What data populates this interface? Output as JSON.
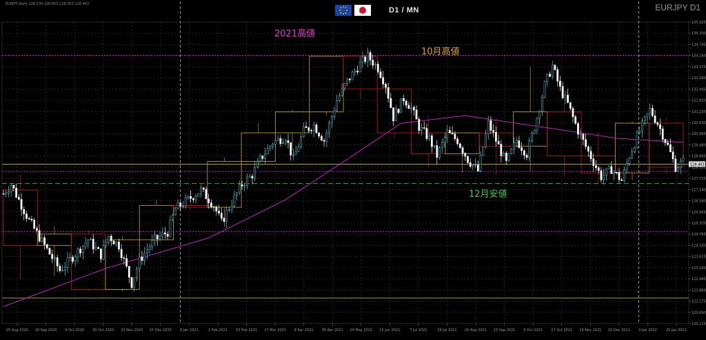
{
  "header": {
    "symbol_info": "EURJPY,Daily  128.530 128.853 128.353 128.463",
    "timeframe_label": "D1 / MN",
    "symbol_title": "EURJPY D1"
  },
  "flags": {
    "left": "eu-flag-icon",
    "right": "japan-flag-icon"
  },
  "colors": {
    "background": "#000000",
    "grid": "#3a3a3a",
    "bull_candle": "#5fd3e0",
    "bear_candle": "#ffffff",
    "ma_line": "#c020c0",
    "monthly_box_bull": "#b8962a",
    "monthly_box_bear": "#b01818",
    "level_magenta": "#d020d0",
    "level_green_dashed": "#22a040",
    "level_khaki": "#9c9c40"
  },
  "annotations": {
    "high_2021": "2021高値",
    "oct_high": "10月高値",
    "dec_low": "12月安値"
  },
  "chart_data": {
    "type": "candlestick",
    "symbol": "EURJPY",
    "timeframe": "Daily",
    "ylim": [
      120.115,
      135.9
    ],
    "y_tick_labels": [
      "135.925",
      "135.330",
      "134.745",
      "134.160",
      "133.575",
      "133.000",
      "132.405",
      "131.820",
      "131.235",
      "130.650",
      "130.065",
      "129.480",
      "128.895",
      "128.310",
      "127.725",
      "127.140",
      "126.540",
      "125.955",
      "125.370",
      "124.785",
      "124.200",
      "123.615",
      "123.030",
      "122.445",
      "121.860",
      "121.275",
      "120.690",
      "120.115"
    ],
    "x_tick_labels": [
      "25 Aug 2020",
      "16 Sep 2020",
      "8 Oct 2020",
      "30 Oct 2020",
      "23 Nov 2020",
      "15 Dec 2020",
      "8 Jan 2021",
      "1 Feb 2021",
      "23 Feb 2021",
      "17 Mar 2021",
      "8 Apr 2021",
      "30 Apr 2021",
      "24 May 2021",
      "15 Jun 2021",
      "7 Jul 2021",
      "29 Jul 2021",
      "20 Aug 2021",
      "13 Sep 2021",
      "5 Oct 2021",
      "27 Oct 2021",
      "18 Nov 2021",
      "10 Dec 2021",
      "3 Jan 2022",
      "25 Jan 2022"
    ],
    "price_path": [
      [
        0,
        126.9
      ],
      [
        3,
        127.4
      ],
      [
        10,
        125.5
      ],
      [
        16,
        124.2
      ],
      [
        22,
        122.9
      ],
      [
        27,
        123.6
      ],
      [
        33,
        124.5
      ],
      [
        38,
        123.7
      ],
      [
        41,
        124.7
      ],
      [
        45,
        124.2
      ],
      [
        50,
        122.2
      ],
      [
        53,
        123.4
      ],
      [
        56,
        124.0
      ],
      [
        59,
        124.5
      ],
      [
        64,
        124.9
      ],
      [
        67,
        126.1
      ],
      [
        72,
        126.6
      ],
      [
        77,
        127.1
      ],
      [
        82,
        126.3
      ],
      [
        85,
        125.4
      ],
      [
        88,
        126.2
      ],
      [
        93,
        127.4
      ],
      [
        97,
        127.9
      ],
      [
        100,
        128.7
      ],
      [
        105,
        129.6
      ],
      [
        110,
        129.9
      ],
      [
        113,
        128.7
      ],
      [
        117,
        130.2
      ],
      [
        121,
        130.5
      ],
      [
        125,
        129.7
      ],
      [
        130,
        131.8
      ],
      [
        134,
        132.8
      ],
      [
        139,
        133.7
      ],
      [
        142,
        134.1
      ],
      [
        146,
        133.5
      ],
      [
        149,
        132.6
      ],
      [
        152,
        130.9
      ],
      [
        156,
        131.9
      ],
      [
        159,
        131.4
      ],
      [
        162,
        130.4
      ],
      [
        166,
        129.8
      ],
      [
        169,
        128.9
      ],
      [
        173,
        130.1
      ],
      [
        177,
        129.7
      ],
      [
        181,
        128.7
      ],
      [
        185,
        128.1
      ],
      [
        189,
        130.6
      ],
      [
        192,
        129.7
      ],
      [
        196,
        128.5
      ],
      [
        200,
        129.7
      ],
      [
        204,
        129.0
      ],
      [
        208,
        130.9
      ],
      [
        211,
        132.6
      ],
      [
        214,
        133.6
      ],
      [
        217,
        132.4
      ],
      [
        220,
        131.6
      ],
      [
        224,
        130.2
      ],
      [
        228,
        129.1
      ],
      [
        233,
        127.8
      ],
      [
        237,
        128.2
      ],
      [
        241,
        127.6
      ],
      [
        244,
        128.9
      ],
      [
        248,
        130.2
      ],
      [
        252,
        131.3
      ],
      [
        255,
        130.6
      ],
      [
        259,
        129.4
      ],
      [
        262,
        128.3
      ],
      [
        265,
        128.6
      ]
    ],
    "moving_average": [
      [
        0,
        121.0
      ],
      [
        40,
        123.0
      ],
      [
        80,
        124.6
      ],
      [
        110,
        126.6
      ],
      [
        135,
        128.8
      ],
      [
        155,
        130.6
      ],
      [
        180,
        131.0
      ],
      [
        210,
        130.4
      ],
      [
        240,
        129.8
      ],
      [
        265,
        129.6
      ]
    ],
    "monthly_boxes": [
      {
        "open": 127.1,
        "close": 124.2,
        "high": 127.9,
        "low": 122.4
      },
      {
        "open": 124.2,
        "close": 124.8,
        "high": 125.2,
        "low": 122.6
      },
      {
        "open": 124.8,
        "close": 121.9,
        "high": 125.0,
        "low": 121.8
      },
      {
        "open": 121.9,
        "close": 124.5,
        "high": 124.7,
        "low": 121.8
      },
      {
        "open": 124.5,
        "close": 126.3,
        "high": 126.6,
        "low": 124.4
      },
      {
        "open": 126.3,
        "close": 126.2,
        "high": 127.1,
        "low": 126.0
      },
      {
        "open": 126.2,
        "close": 128.6,
        "high": 128.8,
        "low": 125.2
      },
      {
        "open": 128.6,
        "close": 130.1,
        "high": 130.6,
        "low": 128.2
      },
      {
        "open": 130.1,
        "close": 131.2,
        "high": 131.3,
        "low": 129.2
      },
      {
        "open": 131.2,
        "close": 134.1,
        "high": 134.1,
        "low": 131.0
      },
      {
        "open": 134.1,
        "close": 132.4,
        "high": 134.1,
        "low": 131.9
      },
      {
        "open": 132.4,
        "close": 130.1,
        "high": 132.3,
        "low": 129.8
      },
      {
        "open": 130.1,
        "close": 129.0,
        "high": 131.0,
        "low": 128.3
      },
      {
        "open": 129.0,
        "close": 130.1,
        "high": 130.1,
        "low": 128.0
      },
      {
        "open": 130.1,
        "close": 129.4,
        "high": 130.9,
        "low": 127.9
      },
      {
        "open": 129.4,
        "close": 131.2,
        "high": 133.6,
        "low": 128.1
      },
      {
        "open": 131.2,
        "close": 128.9,
        "high": 131.7,
        "low": 127.8
      },
      {
        "open": 128.9,
        "close": 128.0,
        "high": 130.1,
        "low": 127.5
      },
      {
        "open": 128.0,
        "close": 130.6,
        "high": 130.7,
        "low": 127.6
      },
      {
        "open": 130.6,
        "close": 128.3,
        "high": 130.9,
        "low": 128.0
      }
    ],
    "levels": [
      {
        "kind": "magenta",
        "y": 134.15
      },
      {
        "kind": "magenta",
        "y": 128.08
      },
      {
        "kind": "magenta",
        "y": 124.93
      },
      {
        "kind": "green_dashed",
        "y": 127.45
      },
      {
        "kind": "khaki",
        "y": 128.45
      },
      {
        "kind": "khaki",
        "y": 121.45
      }
    ],
    "current_price": 128.463,
    "period_separators": [
      "8 Jan 2021",
      "3 Jan 2022"
    ],
    "grid": true
  }
}
